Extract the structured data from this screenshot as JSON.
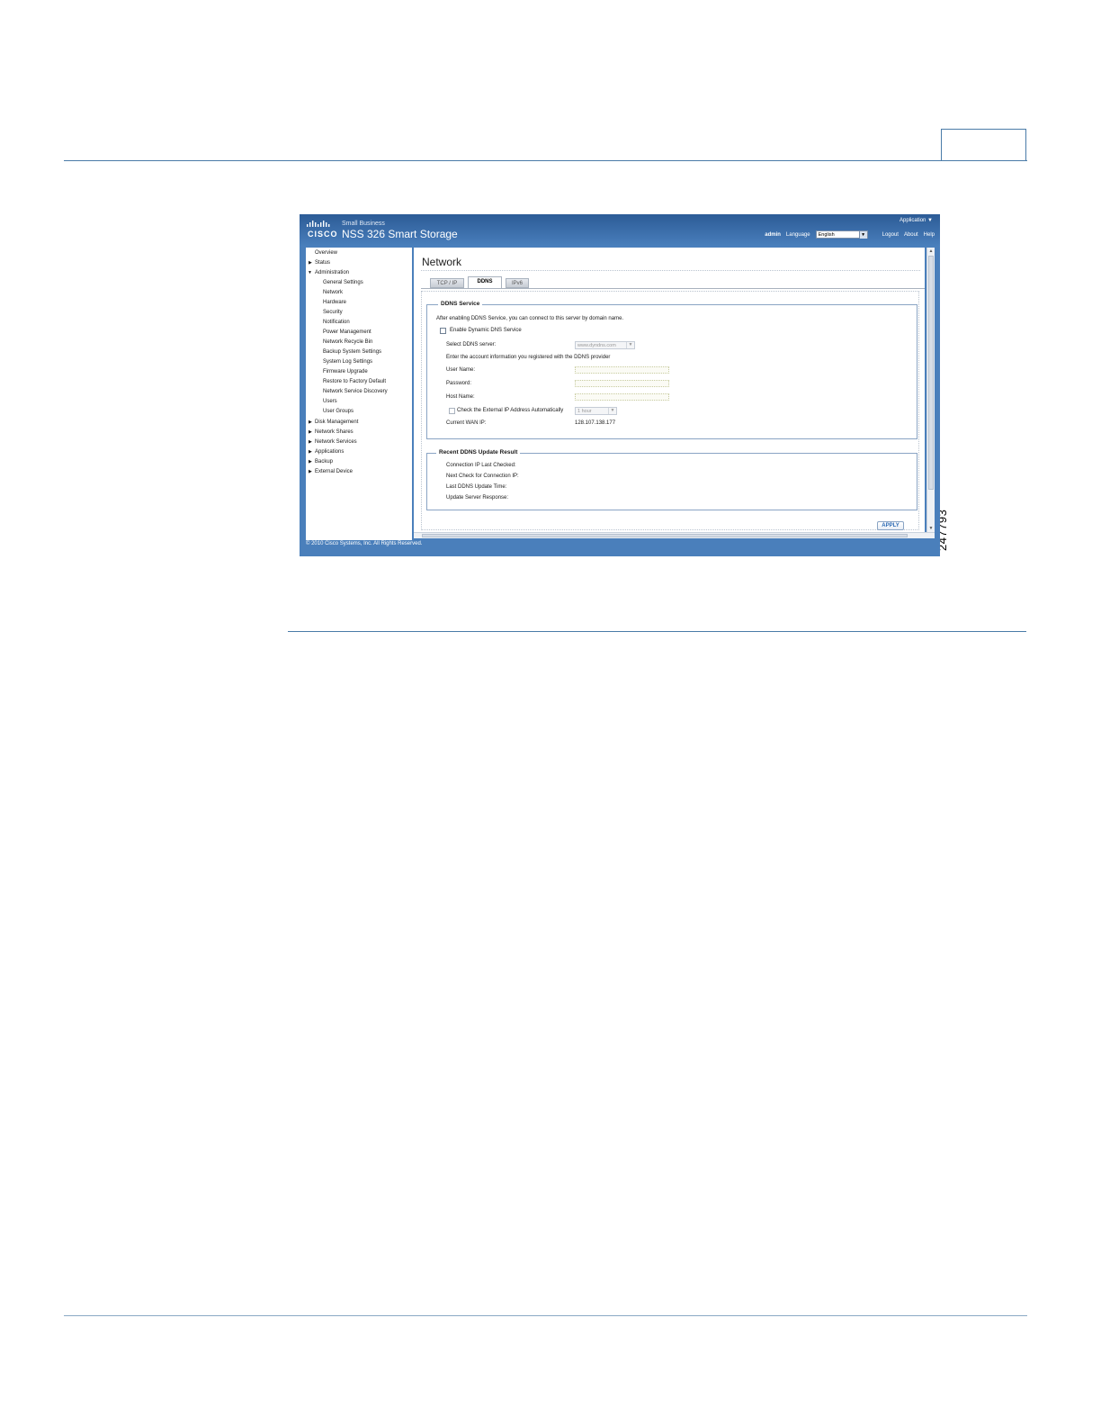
{
  "figure_number": "247793",
  "app": {
    "logo_small": "Small Business",
    "logo_text": "CISCO",
    "product_name": "NSS 326 Smart Storage",
    "application_menu": "Application ▼",
    "user": "admin",
    "language_label": "Language",
    "language_value": "English",
    "logout": "Logout",
    "about": "About",
    "help": "Help",
    "footer": "© 2010 Cisco Systems, Inc. All Rights Reserved."
  },
  "sidebar": {
    "items": [
      "Overview",
      "Status",
      "Administration",
      "General Settings",
      "Network",
      "Hardware",
      "Security",
      "Notification",
      "Power Management",
      "Network Recycle Bin",
      "Backup System Settings",
      "System Log Settings",
      "Firmware Upgrade",
      "Restore to Factory Default",
      "Network Service Discovery",
      "Users",
      "User Groups",
      "Disk Management",
      "Network Shares",
      "Network Services",
      "Applications",
      "Backup",
      "External Device"
    ]
  },
  "main": {
    "title": "Network",
    "tabs": [
      "TCP / IP",
      "DDNS",
      "IPv6"
    ],
    "ddns": {
      "legend": "DDNS Service",
      "intro": "After enabling DDNS Service, you can connect to this server by domain name.",
      "enable_label": "Enable Dynamic DNS Service",
      "select_server_label": "Select DDNS server:",
      "select_server_value": "www.dyndns.com",
      "account_info": "Enter the account information you registered with the DDNS provider",
      "user_name_label": "User Name:",
      "password_label": "Password:",
      "host_name_label": "Host Name:",
      "check_external_label": "Check the External IP Address Automatically",
      "check_interval_value": "1 hour",
      "wan_ip_label": "Current WAN IP:",
      "wan_ip_value": "128.107.138.177"
    },
    "recent": {
      "legend": "Recent DDNS Update Result",
      "connection_ip_label": "Connection IP Last Checked:",
      "next_check_label": "Next Check for Connection IP:",
      "last_update_label": "Last DDNS Update Time:",
      "server_response_label": "Update Server Response:"
    },
    "apply": "APPLY"
  }
}
